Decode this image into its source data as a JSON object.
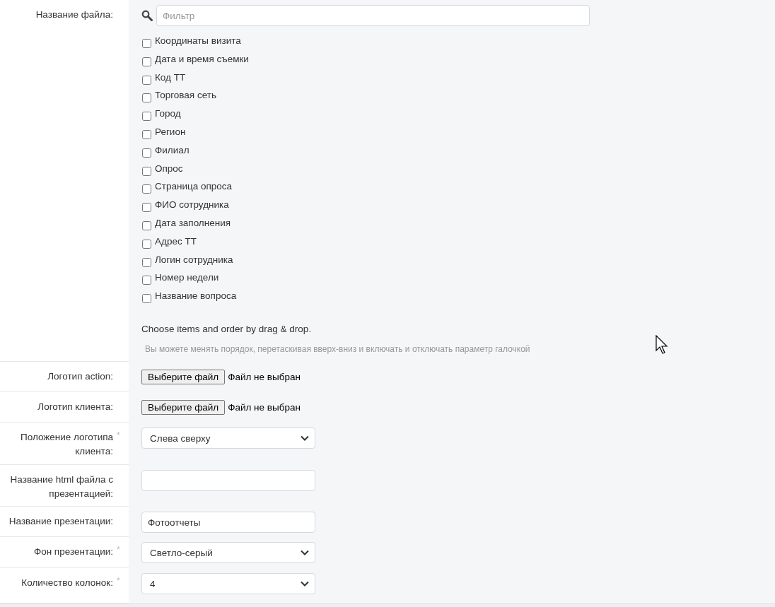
{
  "rows": [
    {
      "kind": "checklist",
      "label": "Название файла:",
      "filter": {
        "placeholder": "Фильтр"
      },
      "items": [
        {
          "label": "Координаты визита",
          "checked": false
        },
        {
          "label": "Дата и время съемки",
          "checked": false
        },
        {
          "label": "Код ТТ",
          "checked": false
        },
        {
          "label": "Торговая сеть",
          "checked": false
        },
        {
          "label": "Город",
          "checked": false
        },
        {
          "label": "Регион",
          "checked": false
        },
        {
          "label": "Филиал",
          "checked": false
        },
        {
          "label": "Опрос",
          "checked": false
        },
        {
          "label": "Страница опроса",
          "checked": false
        },
        {
          "label": "ФИО сотрудника",
          "checked": false
        },
        {
          "label": "Дата заполнения",
          "checked": false
        },
        {
          "label": "Адрес ТТ",
          "checked": false
        },
        {
          "label": "Логин сотрудника",
          "checked": false
        },
        {
          "label": "Номер недели",
          "checked": false
        },
        {
          "label": "Название вопроса",
          "checked": false
        }
      ],
      "instruction": "Choose items and order by drag & drop.",
      "hint": "Вы можете менять порядок, перетаскивая вверх-вниз и включать и отключать параметр галочкой"
    },
    {
      "kind": "file",
      "label": "Логотип action:",
      "button": "Выберите файл",
      "status": "Файл не выбран"
    },
    {
      "kind": "file",
      "label": "Логотип клиента:",
      "button": "Выберите файл",
      "status": "Файл не выбран"
    },
    {
      "kind": "select",
      "label": "Положение логотипа клиента:",
      "asterisk": "*",
      "value": "Слева сверху"
    },
    {
      "kind": "text",
      "label": "Название html файла с презентацией:"
    },
    {
      "kind": "text",
      "label": "Название презентации:",
      "value": "Фотоотчеты"
    },
    {
      "kind": "select",
      "label": "Фон презентации:",
      "asterisk": "*",
      "value": "Светло-серый"
    },
    {
      "kind": "select",
      "label": "Количество колонок:",
      "asterisk": "*",
      "value": "4"
    }
  ]
}
